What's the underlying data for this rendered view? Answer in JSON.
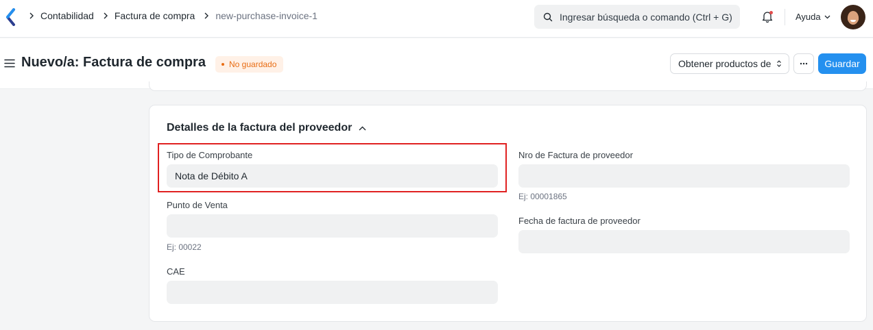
{
  "navbar": {
    "breadcrumbs": [
      "Contabilidad",
      "Factura de compra",
      "new-purchase-invoice-1"
    ],
    "search_placeholder": "Ingresar búsqueda o comando (Ctrl + G)",
    "help_label": "Ayuda"
  },
  "page": {
    "title": "Nuevo/a: Factura de compra",
    "status_badge": "No guardado",
    "get_items_label": "Obtener productos de",
    "save_label": "Guardar"
  },
  "section": {
    "title": "Detalles de la factura del proveedor",
    "fields": {
      "tipo_comprobante": {
        "label": "Tipo de Comprobante",
        "value": "Nota de Débito A"
      },
      "punto_venta": {
        "label": "Punto de Venta",
        "value": "",
        "hint": "Ej: 00022"
      },
      "cae": {
        "label": "CAE",
        "value": ""
      },
      "nro_factura": {
        "label": "Nro de Factura de proveedor",
        "value": "",
        "hint": "Ej: 00001865"
      },
      "fecha_factura": {
        "label": "Fecha de factura de proveedor",
        "value": ""
      }
    }
  },
  "colors": {
    "primary": "#2490ef",
    "badge_text": "#e86c13",
    "badge_bg": "#fff1e7",
    "highlight": "#e02020"
  }
}
